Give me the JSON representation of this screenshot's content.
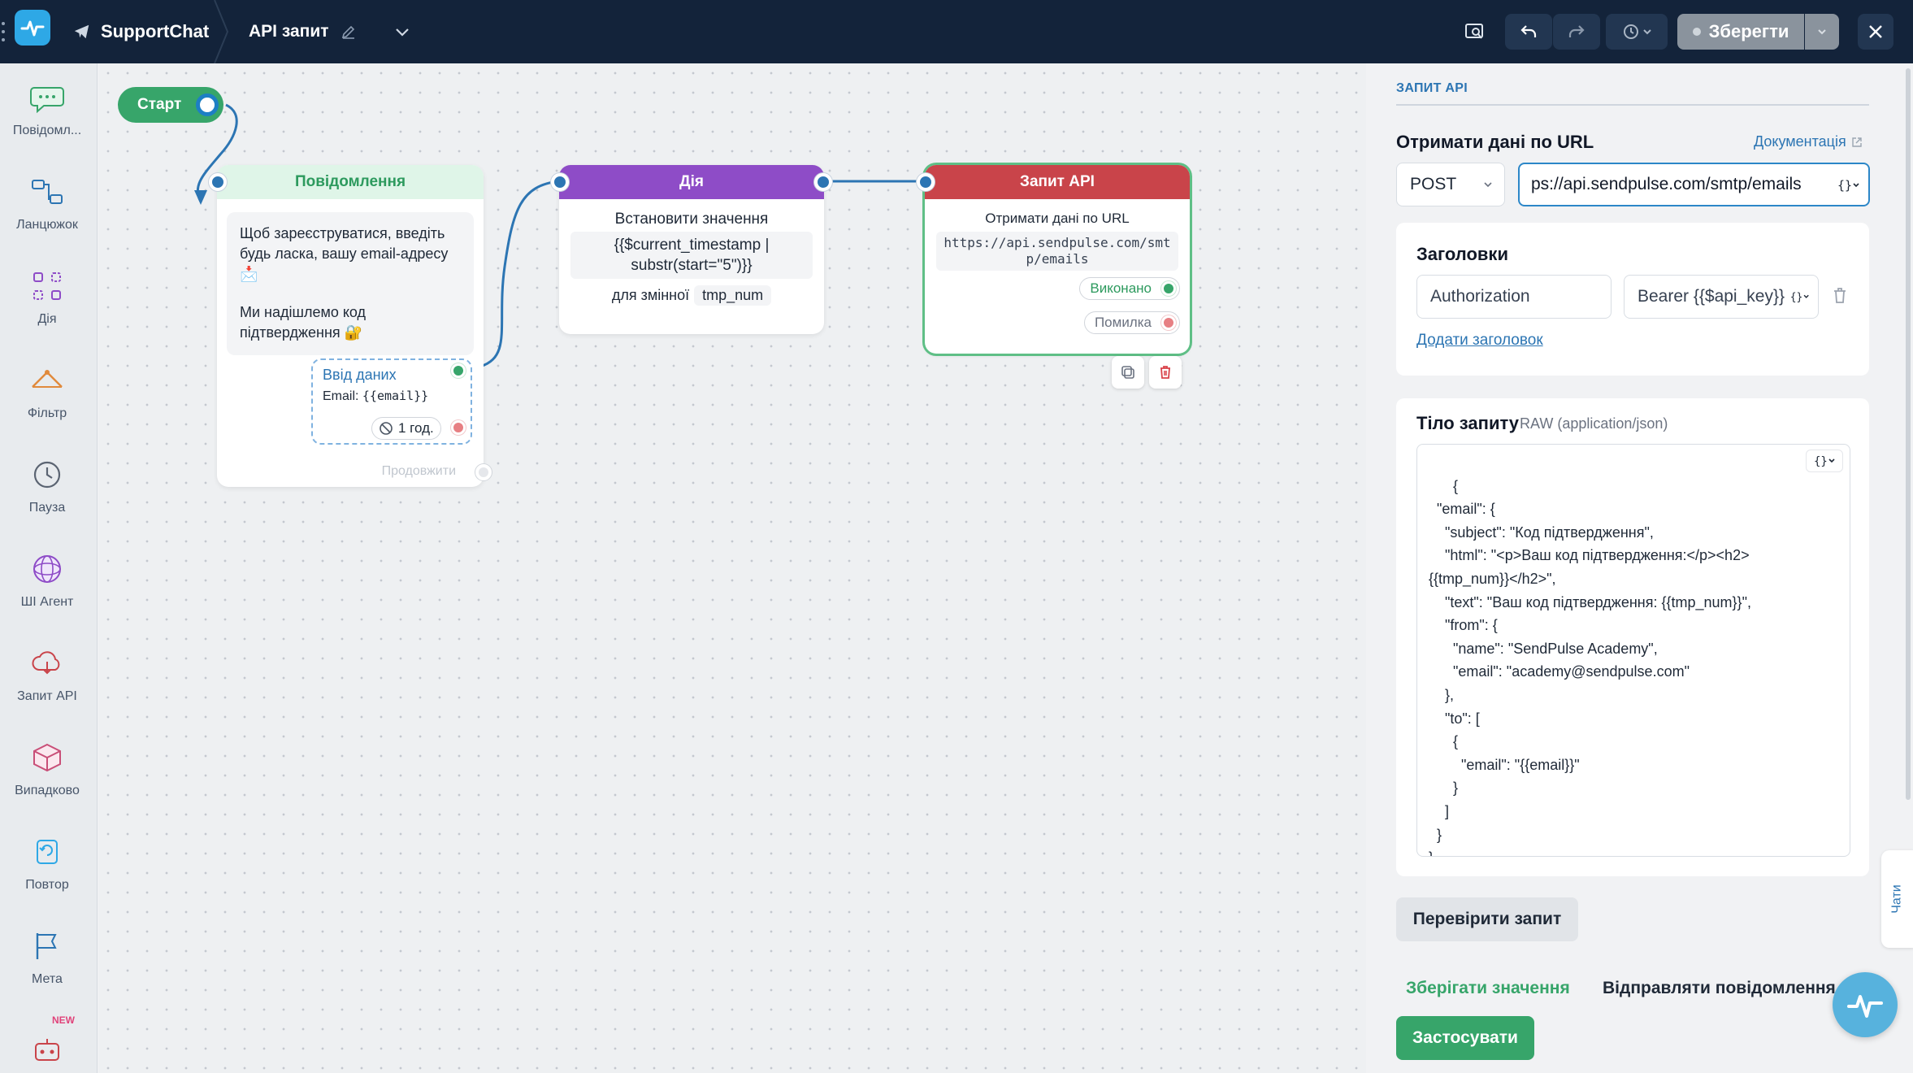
{
  "topbar": {
    "bot_name": "SupportChat",
    "flow_name": "API запит",
    "save_label": "Зберегти"
  },
  "sidebar": {
    "items": [
      {
        "label": "Повідомл..."
      },
      {
        "label": "Ланцюжок"
      },
      {
        "label": "Дія"
      },
      {
        "label": "Фільтр"
      },
      {
        "label": "Пауза"
      },
      {
        "label": "ШІ Агент"
      },
      {
        "label": "Запит API"
      },
      {
        "label": "Випадково"
      },
      {
        "label": "Повтор"
      },
      {
        "label": "Мета"
      }
    ],
    "new_badge": "NEW"
  },
  "canvas": {
    "start_label": "Старт",
    "message_node": {
      "title": "Повідомлення",
      "text_1": "Щоб зареєструватися, введіть будь ласка, вашу email-адресу 📩",
      "text_2": "Ми надішлемо код підтвердження 🔐",
      "input_title": "Ввід даних",
      "input_label": "Email:",
      "input_var": "{{email}}",
      "timeout": "1 год.",
      "continue_label": "Продовжити"
    },
    "action_node": {
      "title": "Дія",
      "line_1": "Встановити значення",
      "code": "{{$current_timestamp | substr(start=\"5\")}}",
      "var_prefix": "для змінної",
      "var_name": "tmp_num"
    },
    "api_node": {
      "title": "Запит API",
      "subtitle": "Отримати дані по URL",
      "url": "https://api.sendpulse.com/smtp/emails",
      "success_label": "Виконано",
      "error_label": "Помилка"
    }
  },
  "panel": {
    "section_title": "ЗАПИТ API",
    "url_label": "Отримати дані по URL",
    "docs_link": "Документація",
    "method": "POST",
    "url_value": "ps://api.sendpulse.com/smtp/emails",
    "headers_title": "Заголовки",
    "header_key": "Authorization",
    "header_value": "Bearer {{$api_key}}",
    "add_header": "Додати заголовок",
    "body_title": "Тіло запиту",
    "body_type": "RAW (application/json)",
    "body_json": "{\n  \"email\": {\n    \"subject\": \"Код підтвердження\",\n    \"html\": \"<p>Ваш код підтвердження:</p><h2>\n{{tmp_num}}</h2>\",\n    \"text\": \"Ваш код підтвердження: {{tmp_num}}\",\n    \"from\": {\n      \"name\": \"SendPulse Academy\",\n      \"email\": \"academy@sendpulse.com\"\n    },\n    \"to\": [\n      {\n        \"email\": \"{{email}}\"\n      }\n    ]\n  }\n}",
    "check_button": "Перевірити запит",
    "tab_save": "Зберігати значення",
    "tab_send": "Відправляти повідомлення",
    "apply_button": "Застосувати",
    "chats_tab": "Чати"
  },
  "colors": {
    "topbar_bg": "#13233a",
    "accent_blue": "#2c75b3",
    "success_green": "#37a56a",
    "action_purple": "#8e4cc7",
    "api_red": "#c9444a"
  }
}
